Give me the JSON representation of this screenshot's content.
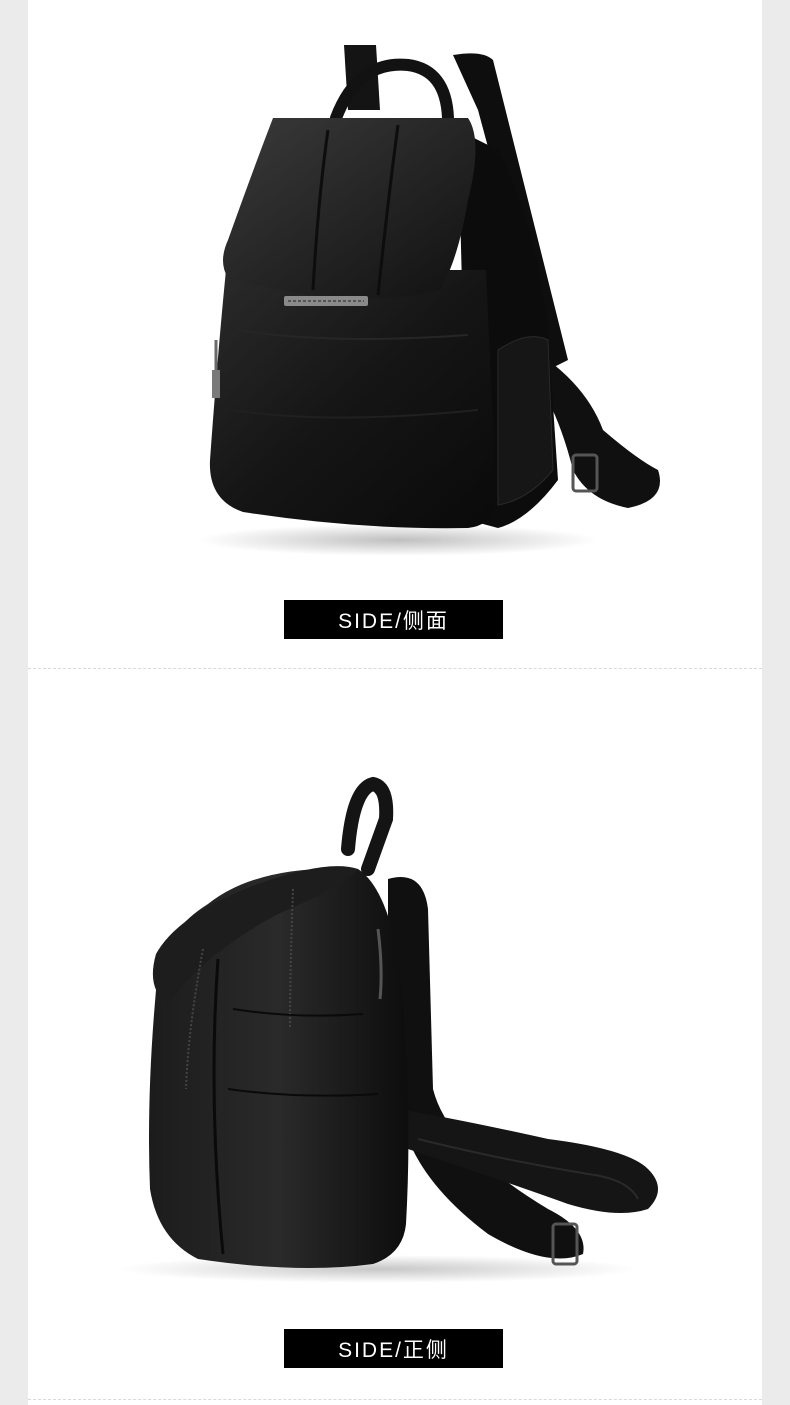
{
  "captions": {
    "top": "SIDE/侧面",
    "bottom": "SIDE/正侧"
  },
  "colors": {
    "background": "#ffffff",
    "side_margin": "#ebebeb",
    "caption_bg": "#000000",
    "caption_text": "#ffffff",
    "leather": "#1a1a1a"
  },
  "images": [
    {
      "subject": "backpack-three-quarter-view"
    },
    {
      "subject": "backpack-side-profile"
    }
  ]
}
